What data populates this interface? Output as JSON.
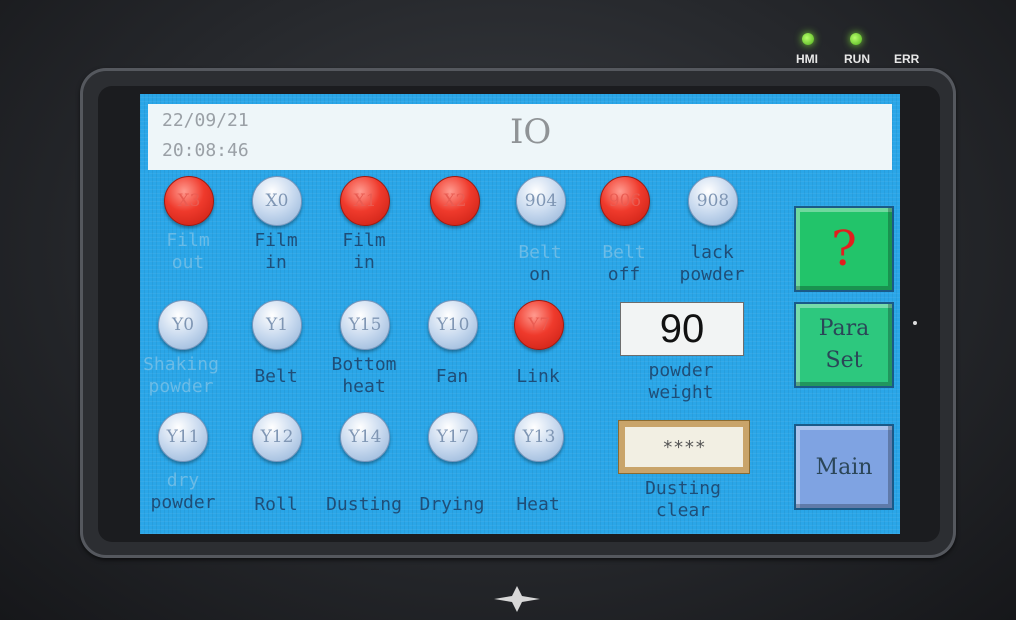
{
  "status_leds": [
    {
      "label": "HMI",
      "state": "on"
    },
    {
      "label": "RUN",
      "state": "on"
    },
    {
      "label": "ERR",
      "state": "off"
    }
  ],
  "header": {
    "date": "22/09/21",
    "time": "20:08:46",
    "title": "IO"
  },
  "inputs_row": [
    {
      "id": "X3",
      "state": "on",
      "label": [
        "Film",
        "out"
      ]
    },
    {
      "id": "X0",
      "state": "off",
      "label": [
        "Film",
        "in"
      ]
    },
    {
      "id": "X1",
      "state": "on",
      "label": [
        "Film",
        "in"
      ]
    },
    {
      "id": "X2",
      "state": "on",
      "label": []
    },
    {
      "id": "904",
      "state": "off",
      "label": [
        "Belt",
        "on"
      ]
    },
    {
      "id": "906",
      "state": "on",
      "label": [
        "Belt",
        "off"
      ]
    },
    {
      "id": "908",
      "state": "off",
      "label": [
        "lack",
        "powder"
      ]
    }
  ],
  "outputs_row1": [
    {
      "id": "Y0",
      "state": "off",
      "label": [
        "Shaking",
        "powder"
      ]
    },
    {
      "id": "Y1",
      "state": "off",
      "label": [
        "Belt"
      ]
    },
    {
      "id": "Y15",
      "state": "off",
      "label": [
        "Bottom",
        "heat"
      ]
    },
    {
      "id": "Y10",
      "state": "off",
      "label": [
        "Fan"
      ]
    },
    {
      "id": "Y7",
      "state": "on",
      "label": [
        "Link"
      ]
    }
  ],
  "outputs_row2": [
    {
      "id": "Y11",
      "state": "off",
      "label": [
        "dry",
        "powder"
      ]
    },
    {
      "id": "Y12",
      "state": "off",
      "label": [
        "Roll"
      ]
    },
    {
      "id": "Y14",
      "state": "off",
      "label": [
        "Dusting"
      ]
    },
    {
      "id": "Y17",
      "state": "off",
      "label": [
        "Drying"
      ]
    },
    {
      "id": "Y13",
      "state": "off",
      "label": [
        "Heat"
      ]
    }
  ],
  "powder_weight": {
    "value": "90",
    "label": [
      "powder",
      "weight"
    ]
  },
  "dusting_clear": {
    "value": "****",
    "label": [
      "Dusting",
      "clear"
    ]
  },
  "side_buttons": {
    "help": "?",
    "para_set": [
      "Para",
      "Set"
    ],
    "main": "Main"
  },
  "colors": {
    "screen_bg": "#2aa6e8",
    "lamp_on": "#ef3a2c",
    "lamp_off": "#c6d8ee",
    "help_btn": "#22c46a",
    "para_btn": "#2dc87e",
    "main_btn": "#7fa3e2"
  }
}
